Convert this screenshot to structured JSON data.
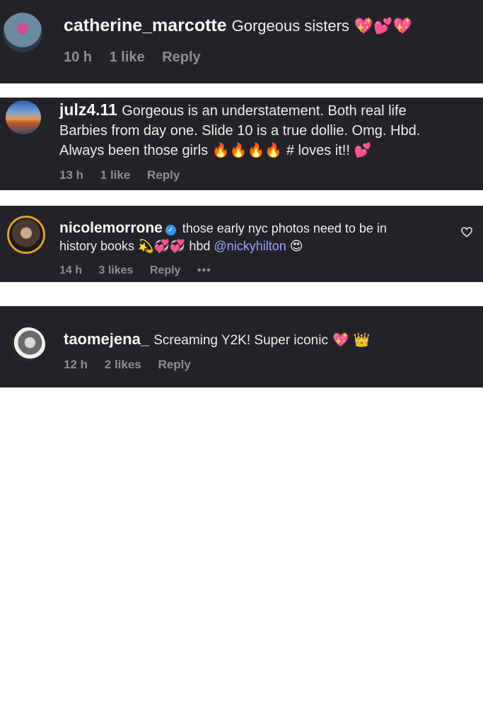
{
  "comments": [
    {
      "username": "catherine_marcotte",
      "lines": [
        "Gorgeous sisters"
      ],
      "emoji": "💖💕💖",
      "time": "10 h",
      "likes": "1 like",
      "reply": "Reply"
    },
    {
      "username": "julz4.11",
      "lines": [
        "Gorgeous is an understatement. Both real life",
        "Barbies from day one. Slide 10 is a true dollie. Omg. Hbd.",
        "Always been those girls"
      ],
      "emoji": "🔥🔥🔥🔥",
      "tail": "# loves it!!",
      "emoji2": "💕",
      "time": "13 h",
      "likes": "1 like",
      "reply": "Reply"
    },
    {
      "username": "nicolemorrone",
      "verified": "✓",
      "lines": [
        "those early nyc photos need to be in",
        "history books"
      ],
      "emoji": "💫💞💞",
      "tail": "hbd",
      "mention": "@nickyhilton",
      "emoji2": "😍",
      "time": "14 h",
      "likes": "3 likes",
      "reply": "Reply",
      "more": "•••"
    },
    {
      "username": "taomejena_",
      "lines": [
        "Screaming Y2K! Super iconic"
      ],
      "emoji": "💖",
      "emoji2": "👑",
      "time": "12 h",
      "likes": "2 likes",
      "reply": "Reply"
    }
  ],
  "colors": {
    "card_bg": "#232227",
    "meta": "#8e8e93",
    "mention": "#9aa4ff",
    "verified": "#3897f0"
  }
}
